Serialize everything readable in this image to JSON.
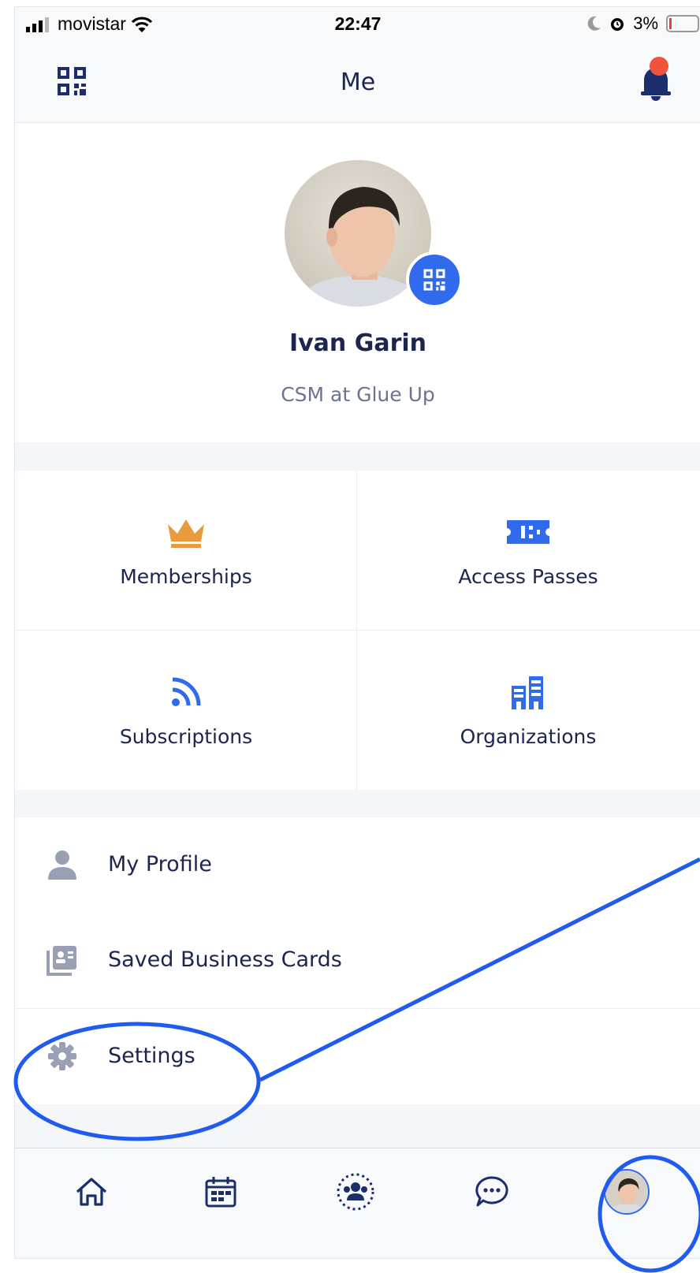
{
  "status_bar": {
    "carrier": "movistar",
    "time": "22:47",
    "battery": "3%"
  },
  "nav": {
    "title": "Me",
    "has_notification": true
  },
  "profile": {
    "name": "Ivan Garin",
    "subtitle": "CSM at Glue Up"
  },
  "tiles": [
    {
      "label": "Memberships",
      "icon": "crown-icon",
      "color": "#e89a3c"
    },
    {
      "label": "Access Passes",
      "icon": "ticket-icon",
      "color": "#2f6bec"
    },
    {
      "label": "Subscriptions",
      "icon": "rss-icon",
      "color": "#2f6bec"
    },
    {
      "label": "Organizations",
      "icon": "buildings-icon",
      "color": "#2f6bec"
    }
  ],
  "menu": [
    {
      "label": "My Profile",
      "icon": "person-icon"
    },
    {
      "label": "Saved Business Cards",
      "icon": "business-card-icon"
    },
    {
      "label": "Settings",
      "icon": "gear-icon"
    }
  ],
  "tabbar": {
    "icons": [
      "home-icon",
      "calendar-icon",
      "community-icon",
      "chat-icon",
      "profile-avatar"
    ]
  },
  "colors": {
    "accent": "#2f6bec",
    "crown": "#e89a3c",
    "notification": "#f0533b",
    "annotation": "#1f5bf0"
  }
}
